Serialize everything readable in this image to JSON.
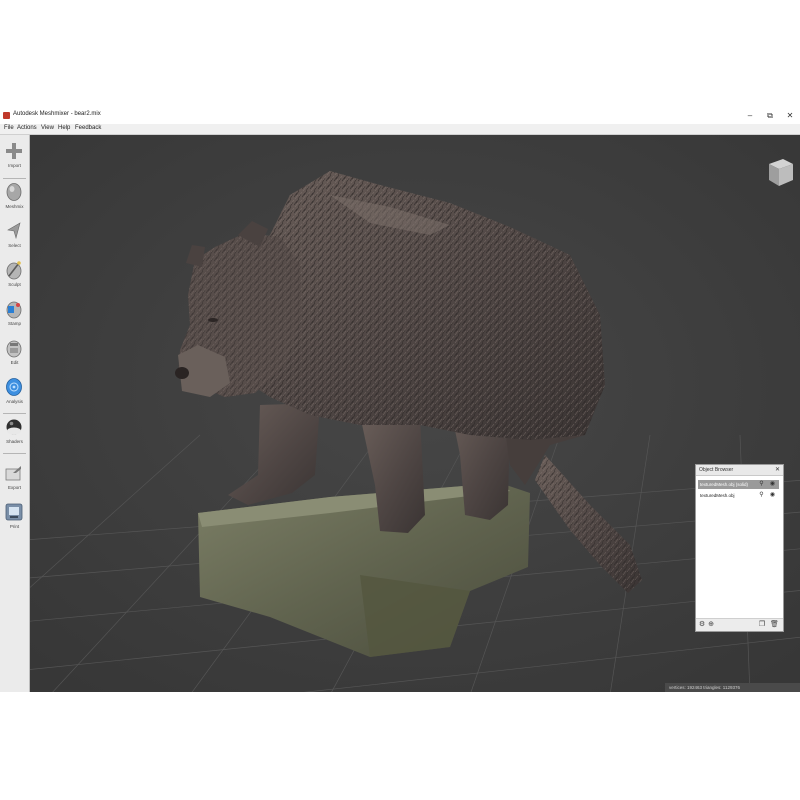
{
  "window": {
    "title": "Autodesk Meshmixer - bear2.mix",
    "controls": {
      "minimize": "–",
      "restore": "⧉",
      "close": "✕"
    }
  },
  "menu": [
    "File",
    "Actions",
    "View",
    "Help",
    "Feedback"
  ],
  "toolbar": {
    "tools": [
      {
        "label": "Import",
        "icon": "plus-icon"
      },
      {
        "label": "Meshmix",
        "icon": "meshmix-icon"
      },
      {
        "label": "Select",
        "icon": "select-arrow-icon"
      },
      {
        "label": "Sculpt",
        "icon": "sculpt-brush-icon"
      },
      {
        "label": "Stamp",
        "icon": "stamp-icon"
      },
      {
        "label": "Edit",
        "icon": "edit-icon"
      },
      {
        "label": "Analysis",
        "icon": "analysis-icon"
      },
      {
        "label": "Shaders",
        "icon": "shaders-icon"
      },
      {
        "label": "Export",
        "icon": "export-icon"
      },
      {
        "label": "Print",
        "icon": "print-icon"
      }
    ]
  },
  "object_browser": {
    "title": "Object Browser",
    "close": "✕",
    "items": [
      {
        "label": "texturedMesh.obj (solid)",
        "selected": true
      },
      {
        "label": "texturedMesh.obj",
        "selected": false
      }
    ]
  },
  "status": {
    "text": "vertices: 192463 triangles: 1129376"
  },
  "colors": {
    "viewport_bg": "#3f3f3f",
    "grid": "#5a5a5a",
    "selection": "#9a9a9a"
  }
}
